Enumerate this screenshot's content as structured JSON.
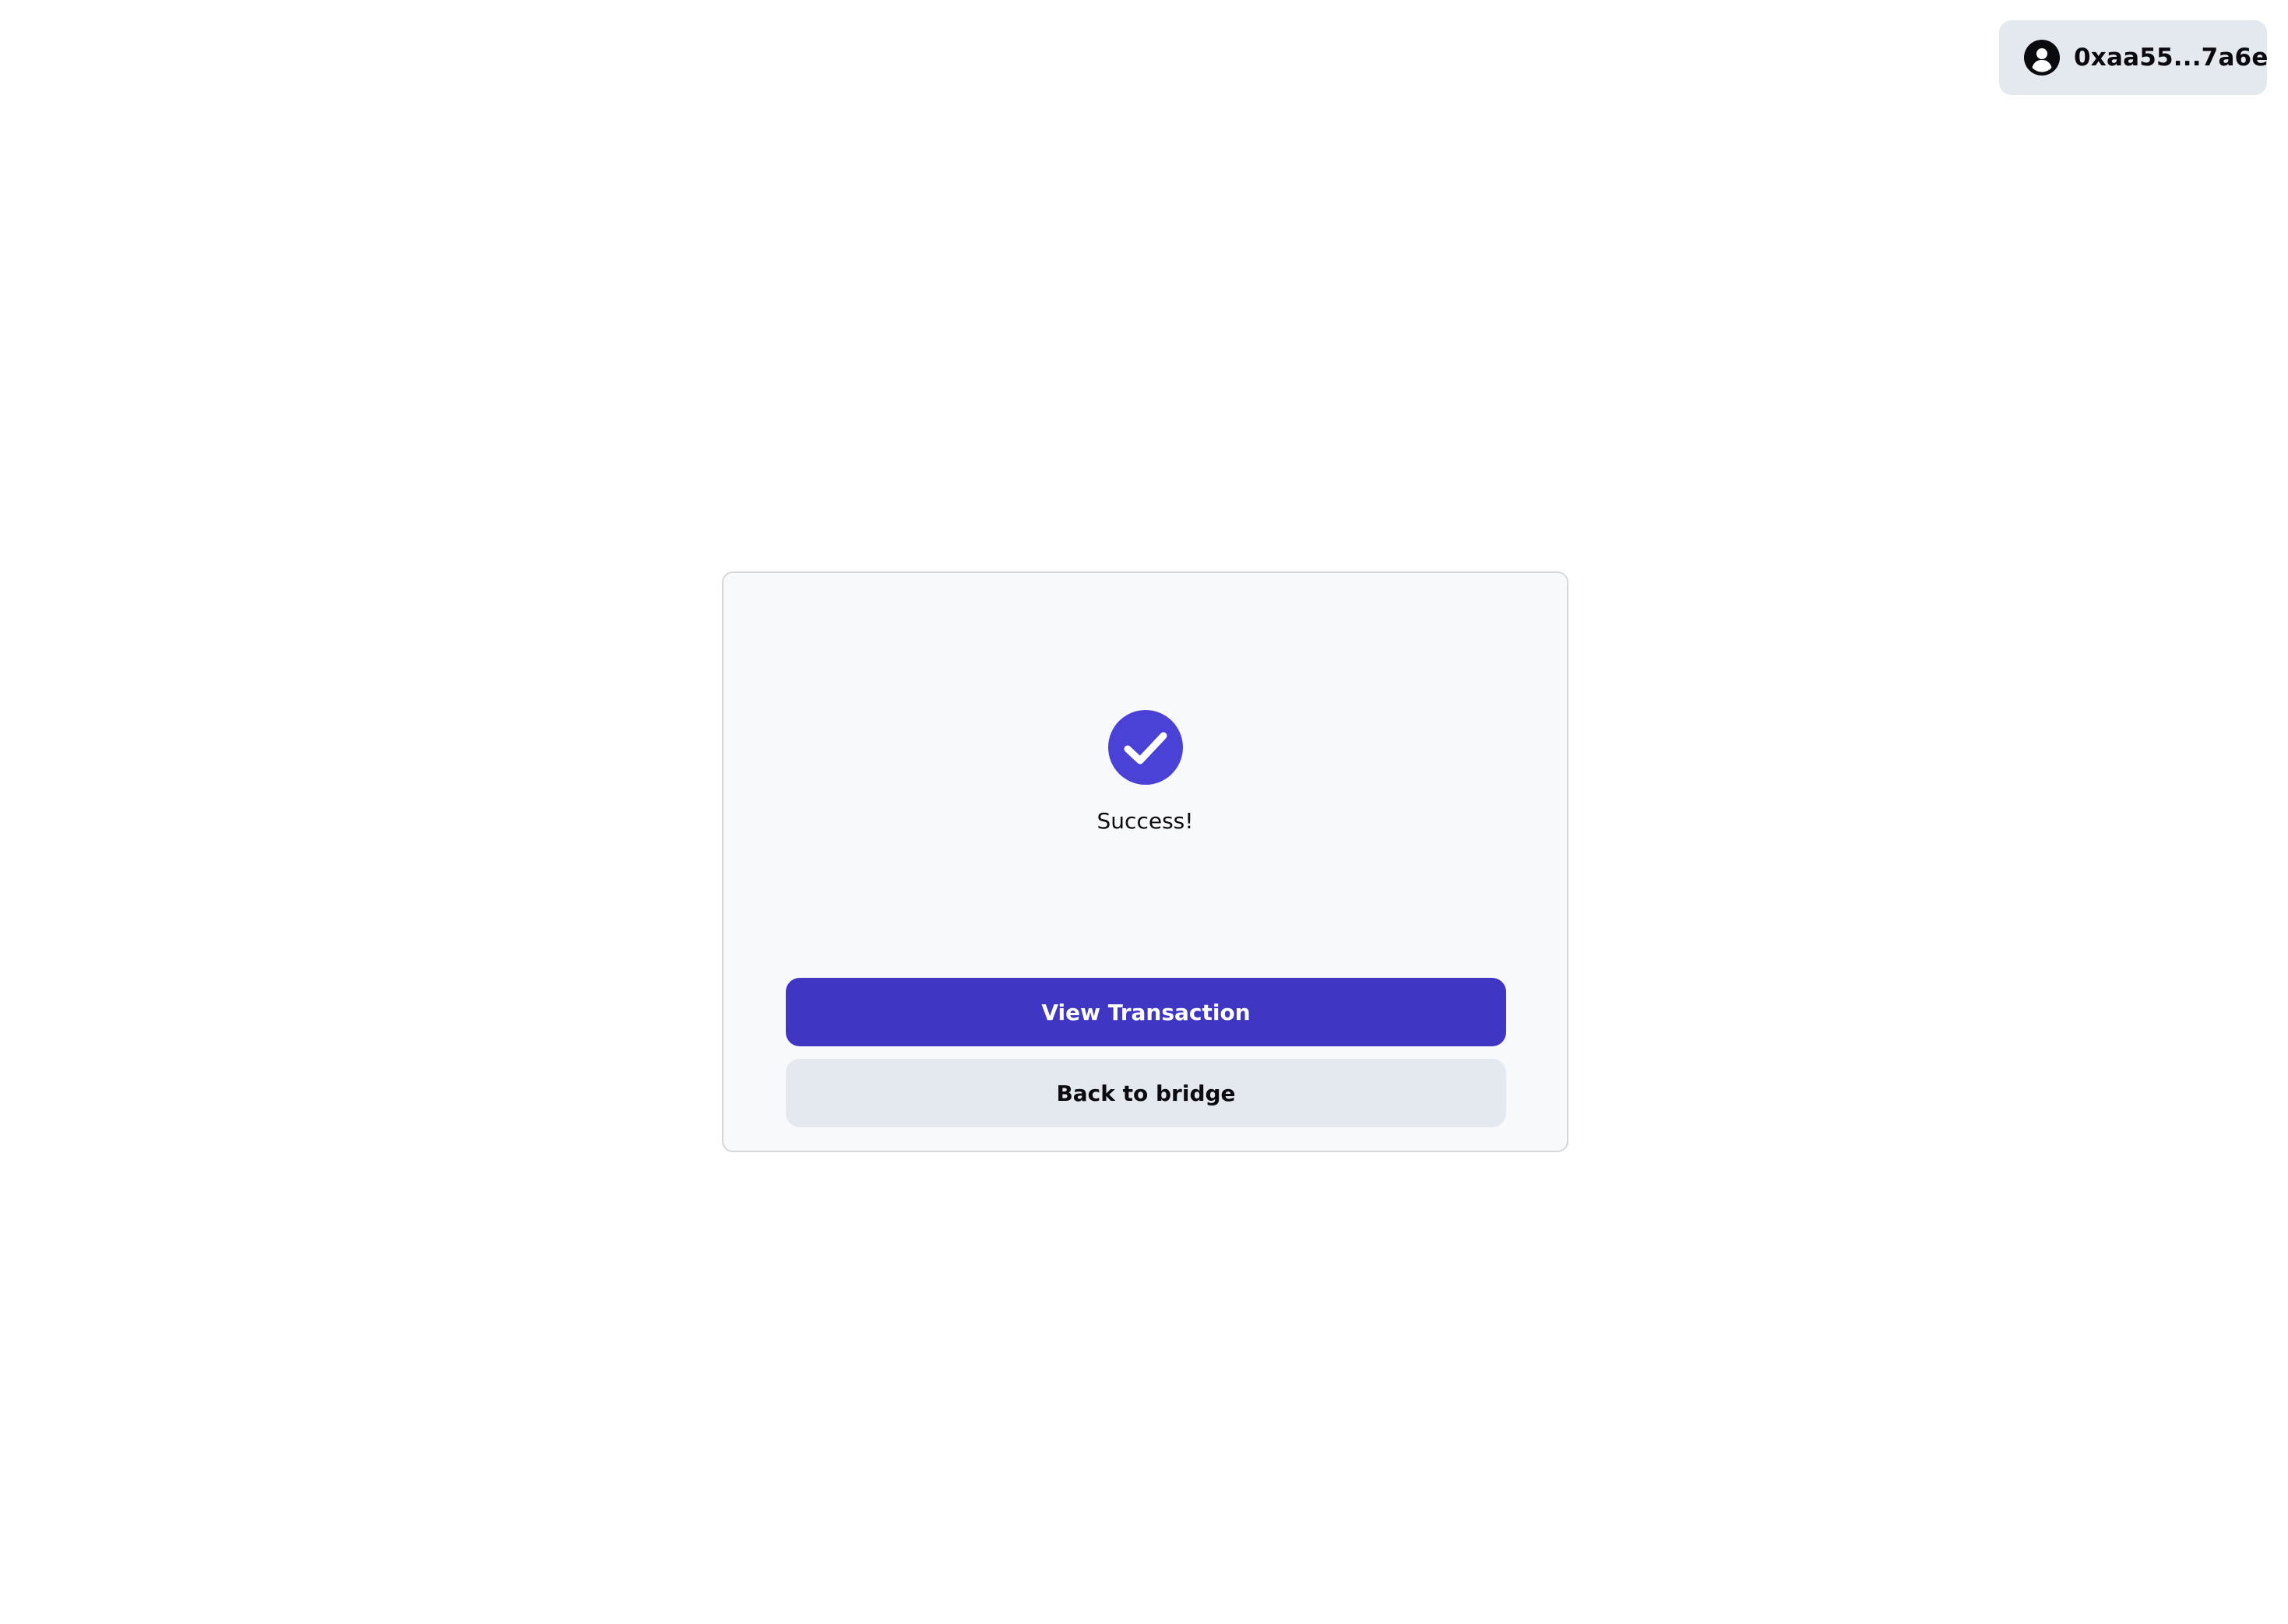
{
  "header": {
    "wallet": {
      "address": "0xaa55...7a6e",
      "icon": "user-circle-icon"
    }
  },
  "success_card": {
    "icon": "check-circle-icon",
    "message": "Success!",
    "primary_button_label": "View Transaction",
    "secondary_button_label": "Back to bridge"
  },
  "colors": {
    "accent": "#3f37c4",
    "check_icon": "#4a42d6",
    "secondary_button": "#e4e8ef",
    "card_background": "#f8f9fa",
    "card_border": "#d6d8dc"
  }
}
